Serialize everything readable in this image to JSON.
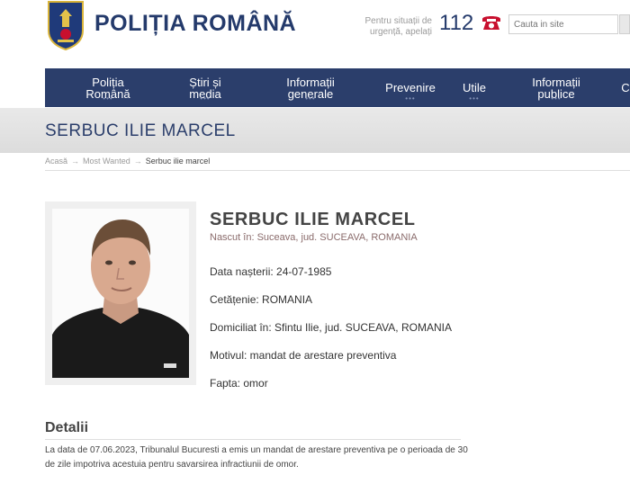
{
  "header": {
    "site_title": "POLIȚIA ROMÂNĂ",
    "emergency_text": "Pentru situații de urgență, apelați",
    "emergency_number": "112",
    "search_placeholder": "Cauta in site"
  },
  "nav": {
    "items": [
      {
        "label": "Poliția\nRomână"
      },
      {
        "label": "Știri și\nmedia"
      },
      {
        "label": "Informații\ngenerale"
      },
      {
        "label": "Prevenire"
      },
      {
        "label": "Utile"
      },
      {
        "label": "Informații\npublice"
      },
      {
        "label": "C"
      }
    ]
  },
  "page": {
    "title": "SERBUC ILIE MARCEL"
  },
  "breadcrumb": {
    "home": "Acasă",
    "section": "Most Wanted",
    "current": "Serbuc ilie marcel"
  },
  "person": {
    "name": "SERBUC ILIE MARCEL",
    "born": "Nascut în: Suceava, jud. SUCEAVA, ROMANIA",
    "birth_date": "Data nașterii: 24-07-1985",
    "citizenship": "Cetățenie: ROMANIA",
    "residence": "Domiciliat în: Sfintu Ilie, jud. SUCEAVA, ROMANIA",
    "reason": "Motivul: mandat de arestare preventiva",
    "offense": "Fapta: omor"
  },
  "details": {
    "heading": "Detalii",
    "text": "La data de 07.06.2023, Tribunalul Bucuresti a emis un mandat de arestare preventiva pe o perioada de 30 de zile impotriva acestuia pentru savarsirea infractiunii de omor."
  },
  "colors": {
    "brand_blue": "#2b3e6b",
    "emergency_red": "#c8102e"
  }
}
